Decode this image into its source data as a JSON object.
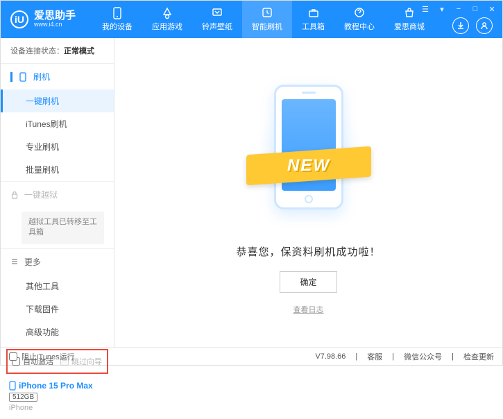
{
  "app": {
    "name": "爱思助手",
    "url": "www.i4.cn",
    "logo_letter": "iU"
  },
  "nav": [
    {
      "label": "我的设备",
      "icon": "device"
    },
    {
      "label": "应用游戏",
      "icon": "apps"
    },
    {
      "label": "铃声壁纸",
      "icon": "ringtone"
    },
    {
      "label": "智能刷机",
      "icon": "flash"
    },
    {
      "label": "工具箱",
      "icon": "toolbox"
    },
    {
      "label": "教程中心",
      "icon": "tutorial"
    },
    {
      "label": "爱思商城",
      "icon": "store"
    }
  ],
  "active_nav": 3,
  "conn": {
    "label": "设备连接状态：",
    "value": "正常模式"
  },
  "side": {
    "flash_head": "刷机",
    "items_flash": [
      "一键刷机",
      "iTunes刷机",
      "专业刷机",
      "批量刷机"
    ],
    "active_flash_item": 0,
    "jailbreak_head": "一键越狱",
    "jailbreak_note": "越狱工具已转移至工具箱",
    "more_head": "更多",
    "items_more": [
      "其他工具",
      "下载固件",
      "高级功能"
    ]
  },
  "checks": {
    "auto_activate": "自动激活",
    "skip_setup": "跳过向导"
  },
  "device": {
    "name": "iPhone 15 Pro Max",
    "storage": "512GB",
    "type": "iPhone"
  },
  "main": {
    "banner": "NEW",
    "success": "恭喜您，保资料刷机成功啦！",
    "ok": "确定",
    "log": "查看日志"
  },
  "status": {
    "block_itunes": "阻止iTunes运行",
    "version": "V7.98.66",
    "links": [
      "客服",
      "微信公众号",
      "检查更新"
    ]
  }
}
